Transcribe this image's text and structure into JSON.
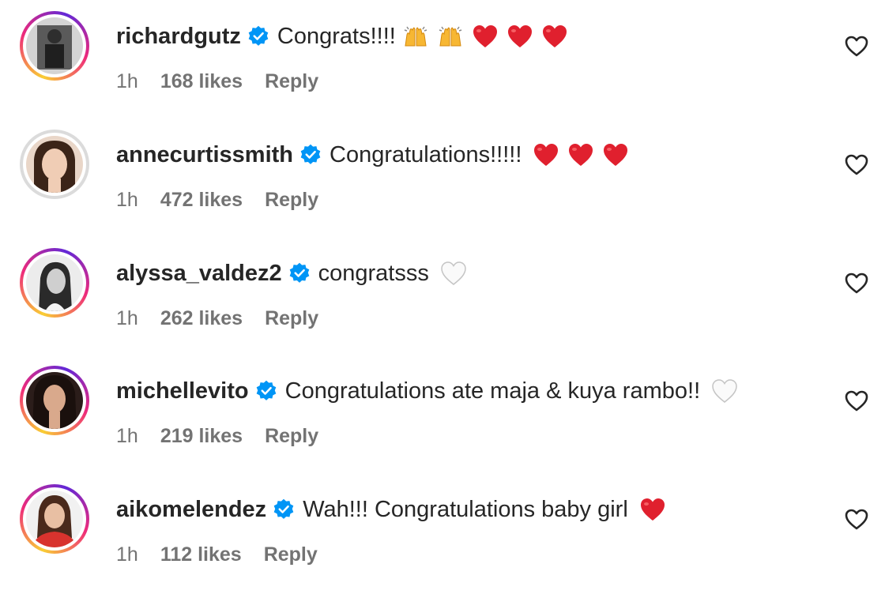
{
  "comments": [
    {
      "username": "richardgutz",
      "text": "Congrats!!!!",
      "emojis": [
        "raising-hands",
        "raising-hands",
        "red-heart",
        "red-heart",
        "red-heart"
      ],
      "time": "1h",
      "likes": "168 likes",
      "reply": "Reply",
      "story_ring": true,
      "avatar_colors": [
        "#cfcfcf",
        "#3a3a3a"
      ]
    },
    {
      "username": "annecurtissmith",
      "text": "Congratulations!!!!!",
      "emojis": [
        "red-heart",
        "red-heart",
        "red-heart"
      ],
      "time": "1h",
      "likes": "472 likes",
      "reply": "Reply",
      "story_ring": false,
      "avatar_colors": [
        "#f2ddd0",
        "#3b2418"
      ]
    },
    {
      "username": "alyssa_valdez2",
      "text": "congratsss",
      "emojis": [
        "white-heart"
      ],
      "time": "1h",
      "likes": "262 likes",
      "reply": "Reply",
      "story_ring": true,
      "avatar_colors": [
        "#e8e8e8",
        "#2a2a2a"
      ]
    },
    {
      "username": "michellevito",
      "text": "Congratulations ate maja & kuya rambo!!",
      "emojis": [
        "white-heart"
      ],
      "time": "1h",
      "likes": "219 likes",
      "reply": "Reply",
      "story_ring": true,
      "avatar_colors": [
        "#2b1d1a",
        "#d9a98c"
      ]
    },
    {
      "username": "aikomelendez",
      "text": "Wah!!! Congratulations baby girl",
      "emojis": [
        "red-heart"
      ],
      "time": "1h",
      "likes": "112 likes",
      "reply": "Reply",
      "story_ring": true,
      "avatar_colors": [
        "#f1f1f1",
        "#d8332e"
      ]
    }
  ],
  "colors": {
    "verified_badge": "#0095f6",
    "meta_text": "#737373",
    "primary_text": "#262626",
    "heart_red": "#e0202e"
  },
  "icons": {
    "verified": "verified-badge-icon",
    "like": "heart-outline-icon"
  }
}
